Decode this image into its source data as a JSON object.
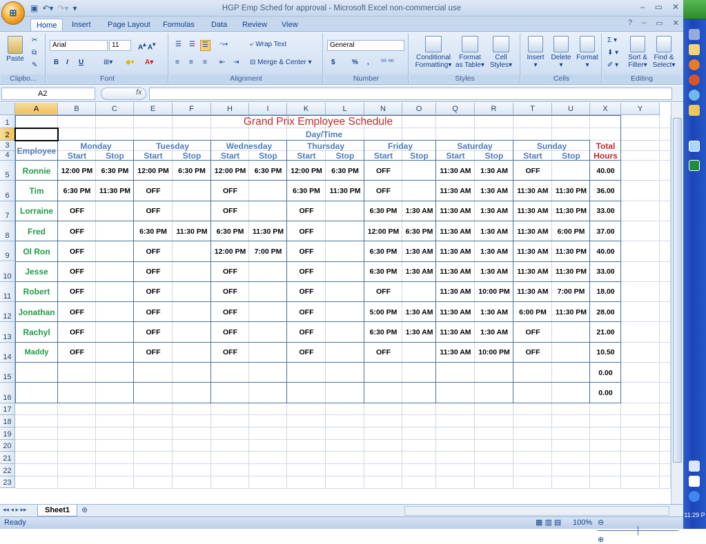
{
  "window": {
    "title": "HGP Emp Sched for approval - Microsoft Excel non-commercial use"
  },
  "ribbon": {
    "tabs": [
      "Home",
      "Insert",
      "Page Layout",
      "Formulas",
      "Data",
      "Review",
      "View"
    ],
    "clipboard": {
      "paste": "Paste",
      "label": "Clipbo..."
    },
    "font": {
      "name": "Arial",
      "size": "11",
      "label": "Font",
      "bold": "B",
      "italic": "I",
      "underline": "U"
    },
    "alignment": {
      "wrap": "Wrap Text",
      "merge": "Merge & Center",
      "label": "Alignment"
    },
    "number": {
      "format": "General",
      "currency": "$",
      "percent": "%",
      "comma": ",",
      "label": "Number"
    },
    "styles": {
      "conditional": "Conditional",
      "formatting": "Formatting",
      "format_as": "Format",
      "as_table": "as Table",
      "cell": "Cell",
      "cell_styles": "Styles",
      "label": "Styles"
    },
    "cells": {
      "insert": "Insert",
      "delete": "Delete",
      "format": "Format",
      "label": "Cells"
    },
    "editing": {
      "sort": "Sort &",
      "filter": "Filter",
      "find": "Find &",
      "select": "Select",
      "label": "Editing"
    }
  },
  "formula_bar": {
    "name_box": "A2",
    "fx": "fx",
    "value": ""
  },
  "sheet": {
    "columns": [
      "A",
      "B",
      "C",
      "E",
      "F",
      "H",
      "I",
      "K",
      "L",
      "N",
      "O",
      "Q",
      "R",
      "T",
      "U",
      "X",
      "Y"
    ],
    "rows": [
      "1",
      "2",
      "3",
      "4",
      "5",
      "6",
      "7",
      "8",
      "9",
      "10",
      "11",
      "12",
      "13",
      "14",
      "15",
      "16",
      "17",
      "18",
      "19",
      "20",
      "21",
      "22",
      "23"
    ],
    "title": "Grand Prix Employee Schedule",
    "day_time": "Day/Time",
    "employee_header": "Employee",
    "days": [
      "Monday",
      "Tuesday",
      "Wednesday",
      "Thursday",
      "Friday",
      "Saturday",
      "Sunday"
    ],
    "start": "Start",
    "stop": "Stop",
    "total": "Total",
    "hours": "Hours",
    "employees": [
      {
        "name": "Ronnie",
        "times": [
          "12:00 PM",
          "6:30 PM",
          "12:00 PM",
          "6:30 PM",
          "12:00 PM",
          "6:30 PM",
          "12:00 PM",
          "6:30 PM",
          "OFF",
          "",
          "11:30 AM",
          "1:30 AM",
          "OFF",
          ""
        ],
        "total": "40.00"
      },
      {
        "name": "Tim",
        "times": [
          "6:30 PM",
          "11:30 PM",
          "OFF",
          "",
          "OFF",
          "",
          "6:30 PM",
          "11:30 PM",
          "OFF",
          "",
          "11:30 AM",
          "1:30 AM",
          "11:30 AM",
          "11:30 PM"
        ],
        "total": "36.00"
      },
      {
        "name": "Lorraine",
        "times": [
          "OFF",
          "",
          "OFF",
          "",
          "OFF",
          "",
          "OFF",
          "",
          "6:30 PM",
          "1:30 AM",
          "11:30 AM",
          "1:30 AM",
          "11:30 AM",
          "11:30 PM"
        ],
        "total": "33.00"
      },
      {
        "name": "Fred",
        "times": [
          "OFF",
          "",
          "6:30 PM",
          "11:30 PM",
          "6:30 PM",
          "11:30 PM",
          "OFF",
          "",
          "12:00 PM",
          "6:30 PM",
          "11:30 AM",
          "1:30 AM",
          "11:30 AM",
          "6:00 PM"
        ],
        "total": "37.00"
      },
      {
        "name": "Ol Ron",
        "times": [
          "OFF",
          "",
          "OFF",
          "",
          "12:00 PM",
          "7:00 PM",
          "OFF",
          "",
          "6:30 PM",
          "1:30 AM",
          "11:30 AM",
          "1:30 AM",
          "11:30 AM",
          "11:30 PM"
        ],
        "total": "40.00"
      },
      {
        "name": "Jesse",
        "times": [
          "OFF",
          "",
          "OFF",
          "",
          "OFF",
          "",
          "OFF",
          "",
          "6:30 PM",
          "1:30 AM",
          "11:30 AM",
          "1:30 AM",
          "11:30 AM",
          "11:30 PM"
        ],
        "total": "33.00"
      },
      {
        "name": "Robert",
        "times": [
          "OFF",
          "",
          "OFF",
          "",
          "OFF",
          "",
          "OFF",
          "",
          "OFF",
          "",
          "11:30 AM",
          "10:00 PM",
          "11:30 AM",
          "7:00 PM"
        ],
        "total": "18.00"
      },
      {
        "name": "Jonathan",
        "times": [
          "OFF",
          "",
          "OFF",
          "",
          "OFF",
          "",
          "OFF",
          "",
          "5:00 PM",
          "1:30 AM",
          "11:30 AM",
          "1:30 AM",
          "6:00 PM",
          "11:30 PM"
        ],
        "total": "28.00"
      },
      {
        "name": "Rachyl",
        "times": [
          "OFF",
          "",
          "OFF",
          "",
          "OFF",
          "",
          "OFF",
          "",
          "6:30 PM",
          "1:30 AM",
          "11:30 AM",
          "1:30 AM",
          "OFF",
          ""
        ],
        "total": "21.00"
      },
      {
        "name": "Maddy",
        "times": [
          "OFF",
          "",
          "OFF",
          "",
          "OFF",
          "",
          "OFF",
          "",
          "OFF",
          "",
          "11:30 AM",
          "10:00 PM",
          "OFF",
          ""
        ],
        "total": "10.50"
      },
      {
        "name": "",
        "times": [
          "",
          "",
          "",
          "",
          "",
          "",
          "",
          "",
          "",
          "",
          "",
          "",
          "",
          ""
        ],
        "total": "0.00"
      },
      {
        "name": "",
        "times": [
          "",
          "",
          "",
          "",
          "",
          "",
          "",
          "",
          "",
          "",
          "",
          "",
          "",
          ""
        ],
        "total": "0.00"
      }
    ],
    "tab_name": "Sheet1"
  },
  "status": {
    "ready": "Ready",
    "zoom": "100%"
  },
  "taskbar": {
    "clock": "11:29 P"
  }
}
